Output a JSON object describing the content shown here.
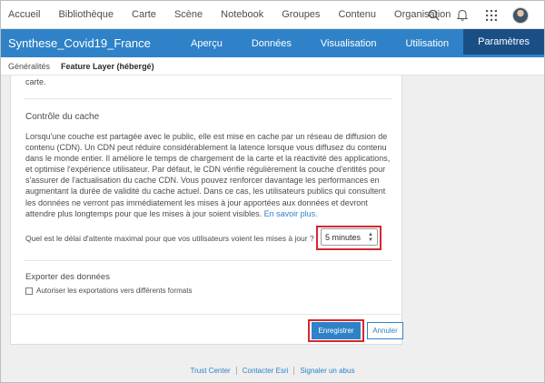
{
  "topnav": {
    "items": [
      "Accueil",
      "Bibliothèque",
      "Carte",
      "Scène",
      "Notebook",
      "Groupes",
      "Contenu",
      "Organisation"
    ],
    "icons": [
      "search-icon",
      "bell-icon",
      "apps-grid-icon"
    ]
  },
  "header": {
    "title": "Synthese_Covid19_France",
    "tabs": [
      "Aperçu",
      "Données",
      "Visualisation",
      "Utilisation",
      "Paramètres"
    ],
    "active_tab": "Paramètres"
  },
  "subtabs": {
    "items": [
      "Généralités",
      "Feature Layer (hébergé)"
    ],
    "active": "Feature Layer (hébergé)"
  },
  "card": {
    "previous_text": "carte.",
    "cache_title": "Contrôle du cache",
    "cache_paragraph": "Lorsqu'une couche est partagée avec le public, elle est mise en cache par un réseau de diffusion de contenu (CDN). Un CDN peut réduire considérablement la latence lorsque vous diffusez du contenu dans le monde entier. Il améliore le temps de chargement de la carte et la réactivité des applications, et optimise l'expérience utilisateur. Par défaut, le CDN vérifie régulièrement la couche d'entités pour s'assurer de l'actualisation du cache CDN. Vous pouvez renforcer davantage les performances en augmentant la durée de validité du cache actuel. Dans ce cas, les utilisateurs publics qui consultent les données ne verront pas immédiatement les mises à jour apportées aux données et devront attendre plus longtemps pour que les mises à jour soient visibles.",
    "learn_more": "En savoir plus.",
    "question": "Quel est le délai d'attente maximal pour que vos utilisateurs voient les mises à jour ?",
    "select_value": "5 minutes",
    "export_title": "Exporter des données",
    "export_checkbox_label": "Autoriser les exportations vers différents formats",
    "export_checked": false,
    "save_label": "Enregistrer",
    "cancel_label": "Annuler"
  },
  "footer": {
    "links": [
      "Trust Center",
      "Contacter Esri",
      "Signaler un abus"
    ]
  },
  "colors": {
    "accent": "#2f82c7",
    "active_tab": "#1a4f86",
    "highlight": "#d8262e"
  }
}
